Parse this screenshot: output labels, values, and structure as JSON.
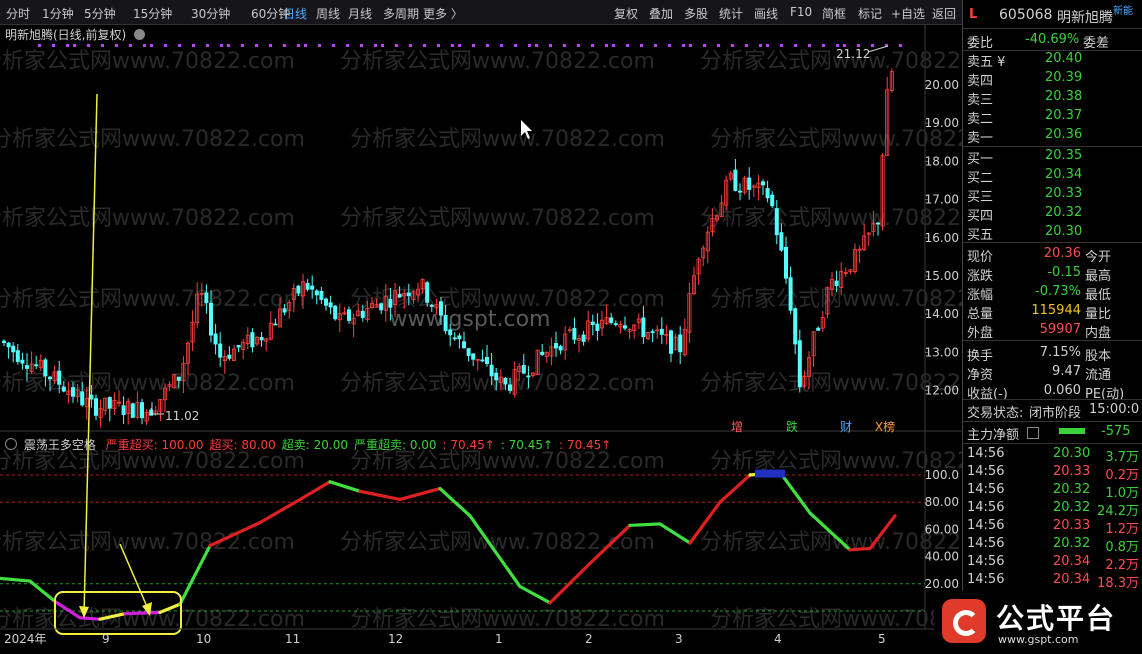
{
  "toolbar": {
    "left_items": [
      "分时",
      "1分钟",
      "5分钟",
      "15分钟",
      "30分钟",
      "60分钟",
      "日线",
      "周线",
      "月线",
      "多周期",
      "更多 〉"
    ],
    "active": "日线",
    "right_items": [
      "复权",
      "叠加",
      "多股",
      "统计",
      "画线",
      "F10",
      "简框",
      "标记",
      "+自选",
      "返回"
    ]
  },
  "main_chart": {
    "title": "明新旭腾(日线,前复权)",
    "high_label": "21.12",
    "low_label": "11.02",
    "price_ticks": [
      "20.00",
      "19.00",
      "18.00",
      "17.00",
      "16.00",
      "15.00",
      "14.00",
      "13.00",
      "12.00"
    ],
    "markers": [
      "增",
      "跌",
      "财",
      "X榜"
    ],
    "watermark_center": "www.gspt.com"
  },
  "indicator": {
    "name": "震荡王多空格",
    "params": [
      {
        "text": "严重超买: 100.00",
        "color": "#ff3b3b"
      },
      {
        "text": "超买: 80.00",
        "color": "#ff3b3b"
      },
      {
        "text": "超卖: 20.00",
        "color": "#3bd13b"
      },
      {
        "text": "严重超卖: 0.00",
        "color": "#3bd13b"
      },
      {
        "text": ": 70.45↑",
        "color": "#ff3b3b"
      },
      {
        "text": ": 70.45↑",
        "color": "#3bd13b"
      },
      {
        "text": ": 70.45↑",
        "color": "#ff3b3b"
      }
    ],
    "ticks": [
      "100.0",
      "80.00",
      "60.00",
      "40.00",
      "20.00"
    ]
  },
  "time_axis": [
    "2024年",
    "9",
    "10",
    "11",
    "12",
    "1",
    "2",
    "3",
    "4",
    "5"
  ],
  "watermark": "分析家公式网www.70822.com",
  "quote": {
    "code": "605068",
    "name": "明新旭腾",
    "flag": "L",
    "weibi_label": "委比",
    "weibi": "-40.69%",
    "weicha_label": "委差",
    "asks": [
      {
        "label": "卖五 ¥",
        "price": "20.40"
      },
      {
        "label": "卖四",
        "price": "20.39"
      },
      {
        "label": "卖三",
        "price": "20.38"
      },
      {
        "label": "卖二",
        "price": "20.37"
      },
      {
        "label": "卖一",
        "price": "20.36"
      }
    ],
    "bids": [
      {
        "label": "买一",
        "price": "20.35"
      },
      {
        "label": "买二",
        "price": "20.34"
      },
      {
        "label": "买三",
        "price": "20.33"
      },
      {
        "label": "买四",
        "price": "20.32"
      },
      {
        "label": "买五",
        "price": "20.30"
      }
    ],
    "stats": [
      {
        "l": "现价",
        "v": "20.36",
        "c": "#ff4d4d",
        "r": "今开"
      },
      {
        "l": "涨跌",
        "v": "-0.15",
        "c": "#3bd13b",
        "r": "最高"
      },
      {
        "l": "涨幅",
        "v": "-0.73%",
        "c": "#3bd13b",
        "r": "最低"
      },
      {
        "l": "总量",
        "v": "115944",
        "c": "#f0c020",
        "r": "量比"
      },
      {
        "l": "外盘",
        "v": "59907",
        "c": "#ff4d4d",
        "r": "内盘"
      },
      {
        "l": "换手",
        "v": "7.15%",
        "c": "#d0d0d0",
        "r": "股本"
      },
      {
        "l": "净资",
        "v": "9.47",
        "c": "#d0d0d0",
        "r": "流通"
      },
      {
        "l": "收益(-)",
        "v": "0.060",
        "c": "#d0d0d0",
        "r": "PE(动)"
      }
    ],
    "trade_status_label": "交易状态:",
    "trade_status": "闭市阶段",
    "trade_time": "15:00:0",
    "main_flow_label": "主力净额",
    "main_flow_value": "-575",
    "ticks": [
      {
        "t": "14:56",
        "p": "20.30",
        "v": "3.7万",
        "c": "#3bd13b"
      },
      {
        "t": "14:56",
        "p": "20.33",
        "v": "0.2万",
        "c": "#ff4d4d"
      },
      {
        "t": "14:56",
        "p": "20.32",
        "v": "1.0万",
        "c": "#3bd13b"
      },
      {
        "t": "14:56",
        "p": "20.32",
        "v": "24.2万",
        "c": "#3bd13b"
      },
      {
        "t": "14:56",
        "p": "20.33",
        "v": "1.2万",
        "c": "#ff4d4d"
      },
      {
        "t": "14:56",
        "p": "20.32",
        "v": "0.8万",
        "c": "#3bd13b"
      },
      {
        "t": "14:56",
        "p": "20.34",
        "v": "2.2万",
        "c": "#ff4d4d"
      },
      {
        "t": "14:56",
        "p": "20.34",
        "v": "18.3万",
        "c": "#ff4d4d"
      }
    ],
    "new_label": "新能"
  },
  "logo": {
    "text": "公式平台",
    "url": "www.gspt.com"
  }
}
